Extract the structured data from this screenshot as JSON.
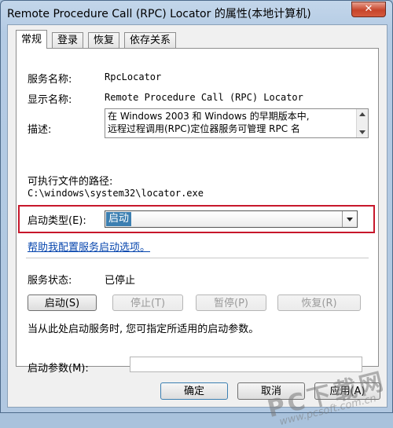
{
  "window": {
    "title": "Remote Procedure Call (RPC) Locator 的属性(本地计算机)",
    "close_glyph": "✕"
  },
  "tabs": [
    "常规",
    "登录",
    "恢复",
    "依存关系"
  ],
  "general": {
    "service_name_label": "服务名称:",
    "service_name_value": "RpcLocator",
    "display_name_label": "显示名称:",
    "display_name_value": "Remote Procedure Call (RPC) Locator",
    "description_label": "描述:",
    "description_line1": "在 Windows 2003 和 Windows 的早期版本中,",
    "description_line2": "远程过程调用(RPC)定位器服务可管理 RPC 名",
    "exe_path_label": "可执行文件的路径:",
    "exe_path_value": "C:\\windows\\system32\\locator.exe",
    "startup_type_label": "启动类型(E):",
    "startup_type_value": "启动",
    "help_link": "帮助我配置服务启动选项。",
    "service_status_label": "服务状态:",
    "service_status_value": "已停止",
    "buttons": {
      "start": "启动(S)",
      "stop": "停止(T)",
      "pause": "暂停(P)",
      "resume": "恢复(R)"
    },
    "start_hint": "当从此处启动服务时, 您可指定所适用的启动参数。",
    "start_params_label": "启动参数(M):",
    "start_params_value": ""
  },
  "dialog_buttons": {
    "ok": "确定",
    "cancel": "取消",
    "apply": "应用(A)"
  },
  "watermark": {
    "main": "PC下载网",
    "sub": "www.pcsoft.com.cn"
  },
  "icons": [
    "close-icon",
    "chevron-down-icon",
    "scroll-up-icon",
    "scroll-down-icon"
  ],
  "colors": {
    "highlight_border": "#c7172b",
    "selection": "#3c7fb1",
    "link": "#0645ad",
    "close_button": "#c7452b"
  }
}
